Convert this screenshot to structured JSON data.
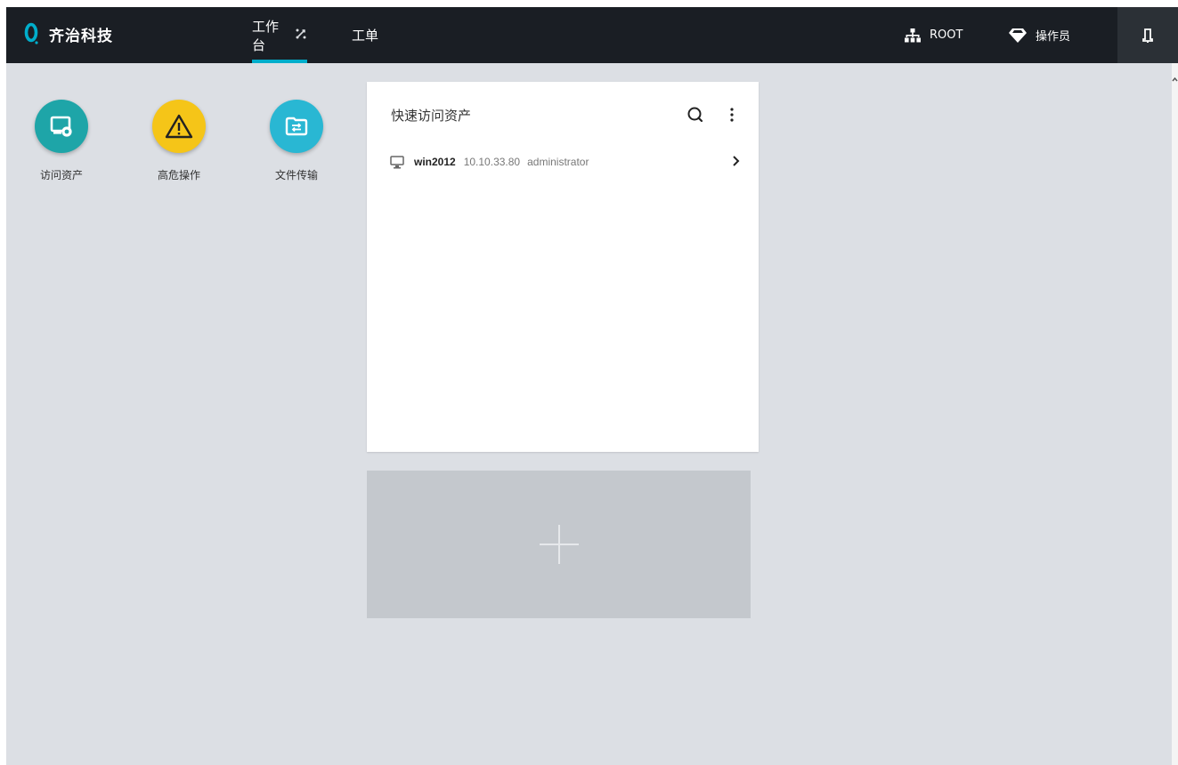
{
  "brand": {
    "name": "齐治科技",
    "accent_color": "#00aecb"
  },
  "nav": {
    "tabs": [
      {
        "label": "工作台",
        "active": true,
        "icon": "shuffle-icon"
      },
      {
        "label": "工单",
        "active": false
      }
    ]
  },
  "header": {
    "org": {
      "label": "ROOT",
      "icon": "org-tree-icon"
    },
    "role": {
      "label": "操作员",
      "icon": "diamond-icon"
    },
    "notifications": {
      "icon": "bell-icon"
    }
  },
  "shortcuts": [
    {
      "label": "访问资产",
      "icon": "monitor-icon",
      "color": "#1ea5a8"
    },
    {
      "label": "高危操作",
      "icon": "warning-icon",
      "color": "#f5c518"
    },
    {
      "label": "文件传输",
      "icon": "file-transfer-icon",
      "color": "#29b7d3"
    }
  ],
  "quick_access": {
    "title": "快速访问资产",
    "assets": [
      {
        "name": "win2012",
        "ip": "10.10.33.80",
        "account": "administrator",
        "icon": "desktop-icon"
      }
    ]
  },
  "add_tile": {
    "icon": "plus-icon"
  }
}
